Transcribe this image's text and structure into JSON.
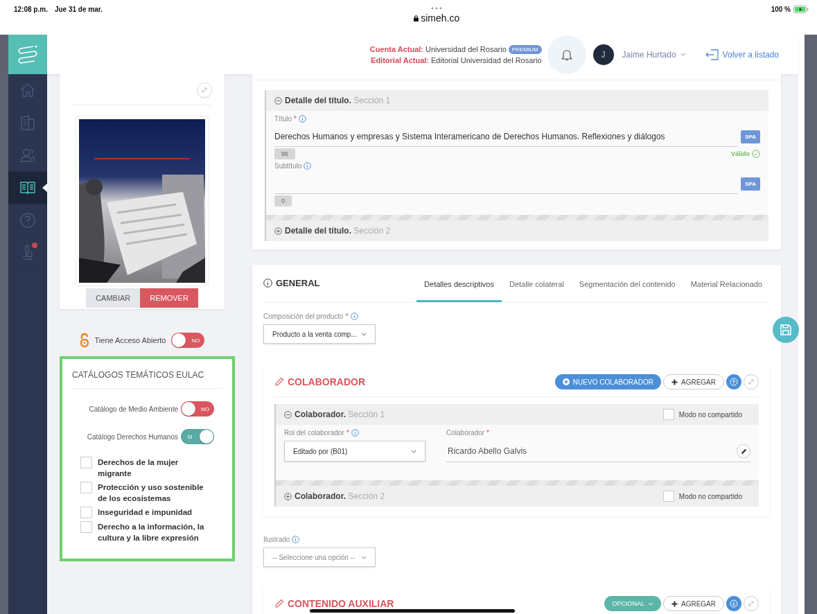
{
  "status_bar": {
    "time": "12:08 p.m.",
    "date": "Jue 31 de mar.",
    "url": "simeh.co",
    "battery": "100 %"
  },
  "header": {
    "account_label": "Cuenta Actual:",
    "account": "Universidad del Rosario",
    "badge": "PREMIUM",
    "editorial_label": "Editorial Actual:",
    "editorial": "Editorial Universidad del Rosario",
    "user_initial": "J",
    "user_name": "Jaime Hurtado",
    "back_link": "Volver a listado"
  },
  "sidebar": {
    "items": [
      {
        "kind": "home",
        "selected": false,
        "alert": false
      },
      {
        "kind": "building",
        "selected": false,
        "alert": false
      },
      {
        "kind": "users",
        "selected": false,
        "alert": false
      },
      {
        "kind": "book",
        "selected": true,
        "alert": false
      },
      {
        "kind": "help",
        "selected": false,
        "alert": false
      },
      {
        "kind": "microscope",
        "selected": false,
        "alert": true
      }
    ]
  },
  "cover": {
    "buttons": [
      {
        "label": "CAMBIAR",
        "kind": "secondary"
      },
      {
        "label": "REMOVER",
        "kind": "danger"
      }
    ]
  },
  "open_access": {
    "label": "Tiene Acceso Abierto",
    "on": false,
    "text": "NO"
  },
  "catalogs": {
    "title": "CATÁLOGOS TEMÁTICOS EULAC",
    "toggles": [
      {
        "label": "Catálogo de Medio Ambiente",
        "on": false,
        "text": "NO"
      },
      {
        "label": "Catálogo Derechos Humanos",
        "on": true,
        "text": "SI"
      }
    ],
    "topics": [
      {
        "label": "Derechos de la mujer migrante",
        "checked": false
      },
      {
        "label": "Protección y uso sostenible de los ecosistemas",
        "checked": false
      },
      {
        "label": "Inseguridad e impunidad",
        "checked": false
      },
      {
        "label": "Derecho a la información, la cultura y la libre expresión",
        "checked": false
      }
    ]
  },
  "title_sections": [
    {
      "title": "Detalle del título.",
      "section": "Sección 1",
      "expanded": true,
      "fields": [
        {
          "label": "Título",
          "required_mark": "*",
          "value": "Derechos Humanos y empresas y Sistema Interamericano de Derechos Humanos. Reflexiones y diálogos",
          "lang": "SPA",
          "count": "96",
          "status": "Válido"
        },
        {
          "label": "Subtítulo",
          "lang": "SPA",
          "count": "0"
        }
      ]
    },
    {
      "title": "Detalle del título.",
      "section": "Sección 2",
      "expanded": false
    }
  ],
  "general": {
    "title": "GENERAL",
    "tabs": [
      {
        "label": "Detalles descriptivos",
        "selected": true
      },
      {
        "label": "Detalle colateral",
        "selected": false
      },
      {
        "label": "Segmentación del contenido",
        "selected": false
      },
      {
        "label": "Material Relacionado",
        "selected": false
      }
    ],
    "composition": {
      "label": "Composición del producto",
      "required_mark": "*",
      "value": "Producto a la venta comp..."
    },
    "collaborator": {
      "title": "COLABORADOR",
      "new_button": "NUEVO COLABORADOR",
      "add_button": "AGREGAR",
      "sections": [
        {
          "title": "Colaborador.",
          "section": "Sección 1",
          "expanded": true,
          "shared_label": "Modo no compartido",
          "unshared": false,
          "role_label": "Rol del colaborador",
          "role_required_mark": "*",
          "role": "Editado por (B01)",
          "person_label": "Colaborador",
          "person_required_mark": "*",
          "person": "Ricardo Abello Galvis"
        },
        {
          "title": "Colaborador.",
          "section": "Sección 2",
          "expanded": false,
          "shared_label": "Modo no compartido",
          "unshared": false
        }
      ]
    },
    "illustrated": {
      "label": "Ilustrado",
      "placeholder": "-- Seleccione una opción --"
    },
    "auxiliary": {
      "title": "CONTENIDO AUXILIAR",
      "option": "OPCIONAL",
      "add_button": "AGREGAR"
    }
  }
}
